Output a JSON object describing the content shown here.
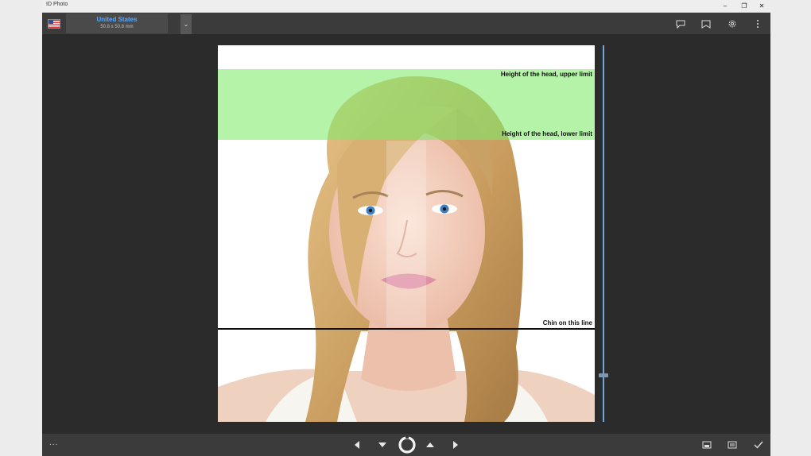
{
  "window": {
    "title": "ID Photo"
  },
  "window_controls": {
    "minimize": "–",
    "restore": "❐",
    "close": "✕"
  },
  "toolbar": {
    "country_name": "United States",
    "photo_size": "50.8 x 50.8 mm",
    "dropdown_glyph": "⌄"
  },
  "guides": {
    "upper_limit_label": "Height of the head, upper limit",
    "lower_limit_label": "Height of the head, lower limit",
    "chin_label": "Chin on this line",
    "band_color": "#7deb69"
  },
  "bottom": {
    "more_label": "..."
  },
  "icons": {
    "toolbar": [
      "comment-icon",
      "bookmark-icon",
      "settings-gear-icon",
      "more-vertical-icon"
    ],
    "bottom": [
      "arrow-left-icon",
      "arrow-down-icon",
      "rotate-icon",
      "arrow-up-icon",
      "arrow-right-icon",
      "save-photo-icon",
      "print-icon",
      "checkmark-icon"
    ]
  },
  "colors": {
    "accent": "#5aa9ff",
    "background": "#2b2b2b",
    "bar": "#3b3b3b"
  }
}
